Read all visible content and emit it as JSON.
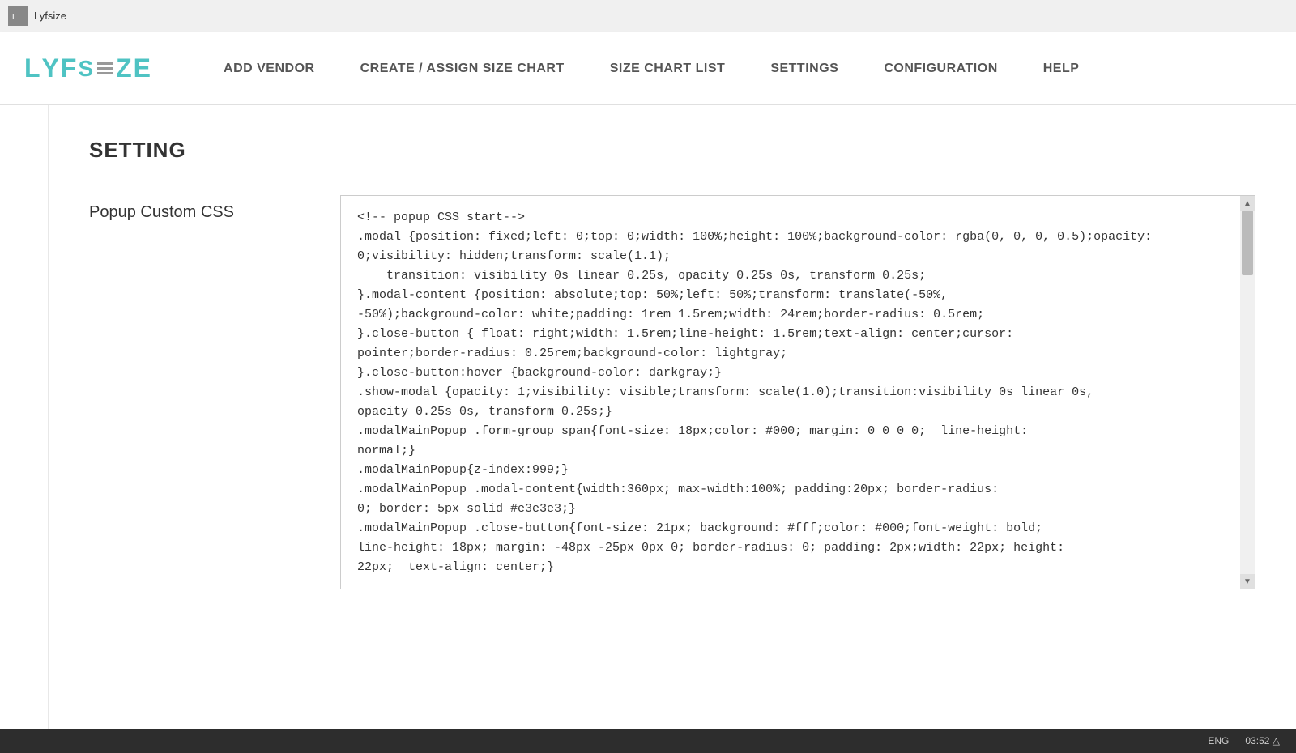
{
  "titlebar": {
    "icon_label": "L",
    "title": "Lyfsize"
  },
  "logo": {
    "letters": [
      "L",
      "Y",
      "F",
      "S",
      "Z",
      "E"
    ]
  },
  "nav": {
    "links": [
      {
        "id": "add-vendor",
        "label": "ADD VENDOR"
      },
      {
        "id": "create-assign",
        "label": "CREATE / ASSIGN SIZE CHART"
      },
      {
        "id": "size-chart-list",
        "label": "SIZE CHART LIST"
      },
      {
        "id": "settings",
        "label": "SETTINGS"
      },
      {
        "id": "configuration",
        "label": "CONFIGURATION"
      },
      {
        "id": "help",
        "label": "HELP"
      }
    ]
  },
  "page": {
    "setting_title": "SETTING",
    "popup_css_label": "Popup Custom CSS",
    "css_content": "<!-- popup CSS start-->\n.modal {position: fixed;left: 0;top: 0;width: 100%;height: 100%;background-color: rgba(0, 0, 0, 0.5);opacity: 0;visibility: hidden;transform: scale(1.1);\n    transition: visibility 0s linear 0.25s, opacity 0.25s 0s, transform 0.25s;\n}.modal-content {position: absolute;top: 50%;left: 50%;transform: translate(-50%, -50%);background-color: white;padding: 1rem 1.5rem;width: 24rem;border-radius: 0.5rem;\n}.close-button { float: right;width: 1.5rem;line-height: 1.5rem;text-align: center;cursor: pointer;border-radius: 0.25rem;background-color: lightgray;\n}.close-button:hover {background-color: darkgray;}\n.show-modal {opacity: 1;visibility: visible;transform: scale(1.0);transition:visibility 0s linear 0s, opacity 0.25s 0s, transform 0.25s;}\n.modalMainPopup .form-group span{font-size: 18px;color: #000; margin: 0 0 0 0;  line-height: normal;}\n.modalMainPopup{z-index:999;}\n.modalMainPopup .modal-content{width:360px; max-width:100%; padding:20px; border-radius: 0; border: 5px solid #e3e3e3;}\n.modalMainPopup .close-button{font-size: 21px; background: #fff;color: #000;font-weight: bold; line-height: 18px; margin: -48px -25px 0px 0; border-radius: 0; padding: 2px;width: 22px; height: 22px;  text-align: center;}"
  },
  "bottombar": {
    "lang": "ENG",
    "time": "03:52 △"
  }
}
